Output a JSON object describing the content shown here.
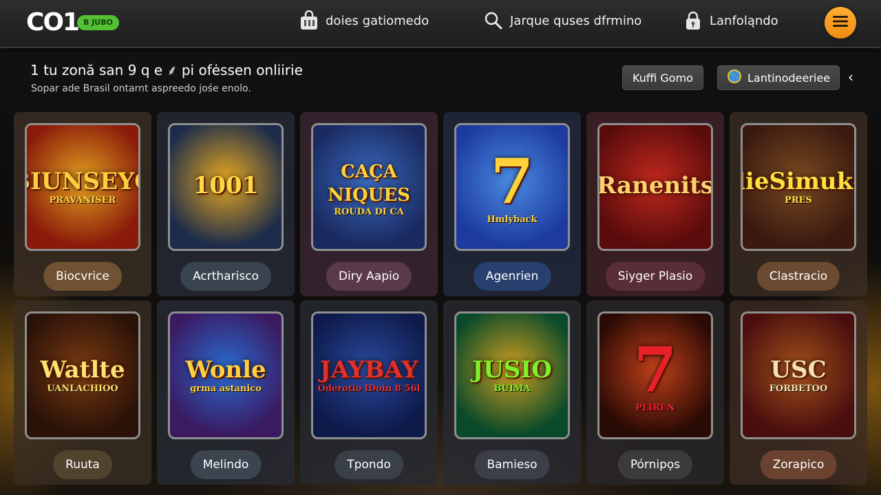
{
  "header": {
    "logo": "CO1",
    "logo_badge": "B JUBO",
    "nav": [
      {
        "label": "doies gatiomedo",
        "icon": "shopping-bag-icon"
      },
      {
        "label": "Jarque quses dfrmino",
        "icon": "search-icon"
      },
      {
        "label": "Lanfoląndo",
        "icon": "lock-icon"
      }
    ],
    "menu_icon": "hamburger-menu-icon"
  },
  "page": {
    "title": "1 tu zonă san 9 q e ⸙ pi ofėssen onliirie",
    "subtitle": "Sopar ade Brasil ontarnt aspreedo jośe enolo.",
    "buttons": {
      "primary": "Kuffi Gomo",
      "secondary": "Lantinodeeriee"
    },
    "chevron": "‹"
  },
  "games": [
    {
      "label": "Biocvrice",
      "art": "BIUNSEYO",
      "art_sub": "PRAVANISER",
      "bg1": "#8a1a0a",
      "bg2": "#e0a020",
      "artColor": "#ffcf40",
      "pill": "#6e5232",
      "card": "rgba(62,48,36,0.78)"
    },
    {
      "label": "Acrtharisco",
      "art": "1001",
      "art_sub": "",
      "bg1": "#1c2c4a",
      "bg2": "#e8a820",
      "artColor": "#ffd84a",
      "pill": "#3a4350",
      "card": "rgba(40,44,56,0.78)"
    },
    {
      "label": "Diry Aapio",
      "art": "CAÇA NIQUES",
      "art_sub": "ROUDA DI CA",
      "bg1": "#1a2a60",
      "bg2": "#3a6ac0",
      "artColor": "#ffd23a",
      "pill": "#5a3a4a",
      "card": "rgba(62,40,52,0.78)"
    },
    {
      "label": "Agenrien",
      "art": "7",
      "art_sub": "Hmlyback",
      "bg1": "#1c3aa0",
      "bg2": "#4a8ae0",
      "artColor": "#ffd23a",
      "pill": "#28406e",
      "card": "rgba(36,44,64,0.78)"
    },
    {
      "label": "Siyger Plasio",
      "art": "Ranenits",
      "art_sub": "",
      "bg1": "#5a0c0c",
      "bg2": "#c0281c",
      "artColor": "#ffd070",
      "pill": "#5a2e36",
      "card": "rgba(66,36,42,0.78)"
    },
    {
      "label": "Clastracio",
      "art": "dieSimuke",
      "art_sub": "PRES",
      "bg1": "#3a1a10",
      "bg2": "#7a4a20",
      "artColor": "#ffe040",
      "pill": "#6a4a30",
      "card": "rgba(60,46,36,0.78)"
    },
    {
      "label": "Ruuta",
      "art": "Watlte",
      "art_sub": "UANLACHIOO",
      "bg1": "#2a1208",
      "bg2": "#7a3a10",
      "artColor": "#ffe070",
      "pill": "#50442e",
      "card": "rgba(56,46,34,0.78)"
    },
    {
      "label": "Melindo",
      "art": "Wonle",
      "art_sub": "grma astanico",
      "bg1": "#3a1a60",
      "bg2": "#2a6ad0",
      "artColor": "#ffd040",
      "pill": "#3c4450",
      "card": "rgba(40,44,54,0.78)"
    },
    {
      "label": "Tpondo",
      "art": "JAYBAY",
      "art_sub": "Oderotio lDoin 8 56l",
      "bg1": "#0e1a4a",
      "bg2": "#2a4aa0",
      "artColor": "#e03030",
      "pill": "#3a4048",
      "card": "rgba(38,42,50,0.78)"
    },
    {
      "label": "Bamieso",
      "art": "JUSIO",
      "art_sub": "BUIMA",
      "bg1": "#0a4a2a",
      "bg2": "#d0a020",
      "artColor": "#7ef02a",
      "pill": "#3c3e48",
      "card": "rgba(40,42,50,0.78)"
    },
    {
      "label": "Pórnipọs",
      "art": "7",
      "art_sub": "PLIREN",
      "bg1": "#2a0a04",
      "bg2": "#c0401a",
      "artColor": "#e8202a",
      "pill": "#3c3a3c",
      "card": "rgba(42,40,44,0.78)"
    },
    {
      "label": "Zorapico",
      "art": "USC",
      "art_sub": "FORBETOO",
      "bg1": "#4a0e0e",
      "bg2": "#a0501a",
      "artColor": "#f4e0b0",
      "pill": "#6a4230",
      "card": "rgba(62,44,34,0.78)"
    }
  ]
}
